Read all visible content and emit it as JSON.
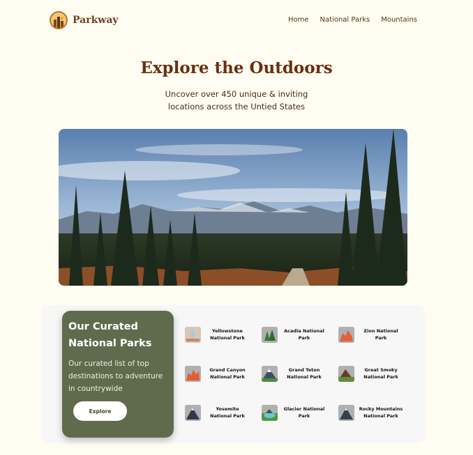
{
  "brand": {
    "name": "Parkway",
    "icon": "mountain-logo-icon"
  },
  "nav": {
    "items": [
      "Home",
      "National Parks",
      "Mountains"
    ]
  },
  "hero": {
    "title": "Explore the Outdoors",
    "subtitle": "Uncover over 450 unique & inviting locations across the Untied States",
    "image": "mountain-forest-landscape"
  },
  "curated": {
    "title": "Our Curated National Parks",
    "description": "Our curated list of top destinations to adventure in countrywide",
    "button": "Explore"
  },
  "parks": [
    {
      "name": "Yellowstone National Park",
      "icon": "geyser-icon"
    },
    {
      "name": "Acadia National Park",
      "icon": "pine-trees-icon"
    },
    {
      "name": "Zion National Park",
      "icon": "red-rock-icon"
    },
    {
      "name": "Grand Canyon National Park",
      "icon": "canyon-icon"
    },
    {
      "name": "Grand Teton National Park",
      "icon": "snow-peak-icon"
    },
    {
      "name": "Great Smoky National Park",
      "icon": "hills-icon"
    },
    {
      "name": "Yosemite National Park",
      "icon": "granite-dome-icon"
    },
    {
      "name": "Glacier National Park",
      "icon": "glacier-lake-icon"
    },
    {
      "name": "Rocky Mountains National Park",
      "icon": "rocky-peak-icon"
    }
  ],
  "colors": {
    "background": "#fffdf2",
    "brand_brown": "#6b2e0e",
    "card_green": "#5f6b4c",
    "section_gray": "#f7f7f8"
  }
}
